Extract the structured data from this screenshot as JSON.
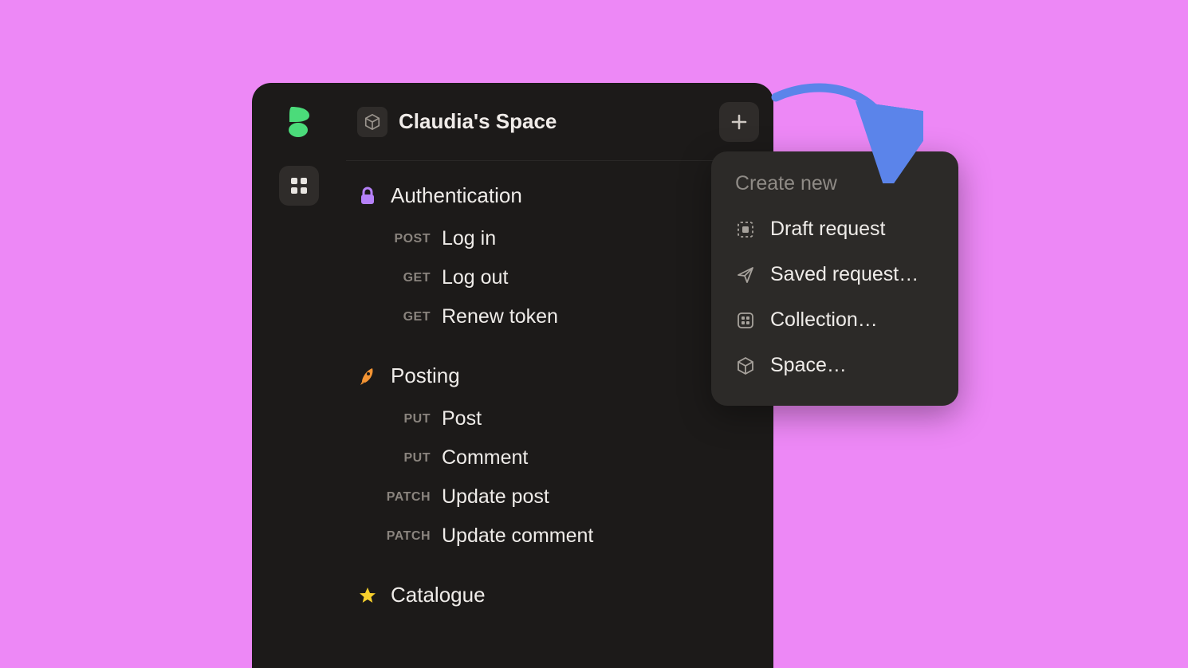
{
  "header": {
    "space_title": "Claudia's Space"
  },
  "collections": [
    {
      "icon": "lock",
      "icon_color": "#b581f8",
      "title": "Authentication",
      "requests": [
        {
          "method": "POST",
          "name": "Log in"
        },
        {
          "method": "GET",
          "name": "Log out"
        },
        {
          "method": "GET",
          "name": "Renew token"
        }
      ]
    },
    {
      "icon": "rocket",
      "icon_color": "#f49433",
      "title": "Posting",
      "requests": [
        {
          "method": "PUT",
          "name": "Post"
        },
        {
          "method": "PUT",
          "name": "Comment"
        },
        {
          "method": "PATCH",
          "name": "Update post"
        },
        {
          "method": "PATCH",
          "name": "Update comment"
        }
      ]
    },
    {
      "icon": "star",
      "icon_color": "#f7cf2c",
      "title": "Catalogue",
      "requests": []
    }
  ],
  "popover": {
    "heading": "Create new",
    "items": [
      {
        "icon": "draft",
        "label": "Draft request"
      },
      {
        "icon": "send",
        "label": "Saved request…"
      },
      {
        "icon": "collection",
        "label": "Collection…"
      },
      {
        "icon": "space",
        "label": "Space…"
      }
    ]
  },
  "colors": {
    "bg": "#ed88f6",
    "window": "#1c1a19",
    "panel": "#2c2a28",
    "accent": "#4bdb7a",
    "arrow": "#5b84ea"
  }
}
